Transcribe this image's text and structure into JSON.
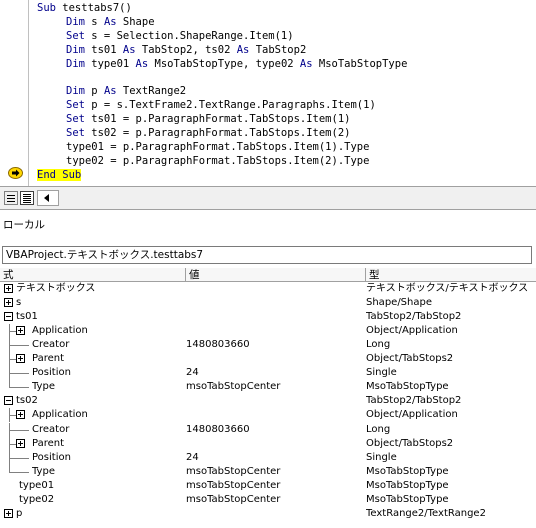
{
  "code": {
    "lines": [
      {
        "indent": 0,
        "tokens": [
          {
            "t": "Sub",
            "kw": true
          },
          {
            "t": " testtabs7()"
          }
        ]
      },
      {
        "indent": 1,
        "tokens": [
          {
            "t": "Dim",
            "kw": true
          },
          {
            "t": " s "
          },
          {
            "t": "As",
            "kw": true
          },
          {
            "t": " Shape"
          }
        ]
      },
      {
        "indent": 1,
        "tokens": [
          {
            "t": "Set",
            "kw": true
          },
          {
            "t": " s = Selection.ShapeRange.Item(1)"
          }
        ]
      },
      {
        "indent": 1,
        "tokens": [
          {
            "t": "Dim",
            "kw": true
          },
          {
            "t": " ts01 "
          },
          {
            "t": "As",
            "kw": true
          },
          {
            "t": " TabStop2, ts02 "
          },
          {
            "t": "As",
            "kw": true
          },
          {
            "t": " TabStop2"
          }
        ]
      },
      {
        "indent": 1,
        "tokens": [
          {
            "t": "Dim",
            "kw": true
          },
          {
            "t": " type01 "
          },
          {
            "t": "As",
            "kw": true
          },
          {
            "t": " MsoTabStopType, type02 "
          },
          {
            "t": "As",
            "kw": true
          },
          {
            "t": " MsoTabStopType"
          }
        ]
      },
      {
        "indent": 0,
        "tokens": []
      },
      {
        "indent": 1,
        "tokens": [
          {
            "t": "Dim",
            "kw": true
          },
          {
            "t": " p "
          },
          {
            "t": "As",
            "kw": true
          },
          {
            "t": " TextRange2"
          }
        ]
      },
      {
        "indent": 1,
        "tokens": [
          {
            "t": "Set",
            "kw": true
          },
          {
            "t": " p = s.TextFrame2.TextRange.Paragraphs.Item(1)"
          }
        ]
      },
      {
        "indent": 1,
        "tokens": [
          {
            "t": "Set",
            "kw": true
          },
          {
            "t": " ts01 = p.ParagraphFormat.TabStops.Item(1)"
          }
        ]
      },
      {
        "indent": 1,
        "tokens": [
          {
            "t": "Set",
            "kw": true
          },
          {
            "t": " ts02 = p.ParagraphFormat.TabStops.Item(2)"
          }
        ]
      },
      {
        "indent": 1,
        "tokens": [
          {
            "t": "type01 = p.ParagraphFormat.TabStops.Item(1).Type"
          }
        ]
      },
      {
        "indent": 1,
        "tokens": [
          {
            "t": "type02 = p.ParagraphFormat.TabStops.Item(2).Type"
          }
        ]
      },
      {
        "indent": 0,
        "tokens": [
          {
            "t": "End Sub",
            "kw": true,
            "hl": true
          }
        ]
      }
    ],
    "exec_line_index": 12,
    "exec_arrow_color": "#ffd700"
  },
  "locals": {
    "title": "ローカル",
    "context": "VBAProject.テキストボックス.testtabs7",
    "headers": [
      "式",
      "値",
      "型"
    ],
    "rows": [
      {
        "level": 0,
        "expander": "plus",
        "expr": "テキストボックス",
        "value": "",
        "type": "テキストボックス/テキストボックス"
      },
      {
        "level": 0,
        "expander": "plus",
        "expr": "s",
        "value": "",
        "type": "Shape/Shape"
      },
      {
        "level": 0,
        "expander": "minus",
        "expr": "ts01",
        "value": "",
        "type": "TabStop2/TabStop2"
      },
      {
        "level": 1,
        "expander": "plus",
        "expr": "Application",
        "value": "",
        "type": "Object/Application"
      },
      {
        "level": 1,
        "expander": "none",
        "expr": "Creator",
        "value": "1480803660",
        "type": "Long"
      },
      {
        "level": 1,
        "expander": "plus",
        "expr": "Parent",
        "value": "",
        "type": "Object/TabStops2"
      },
      {
        "level": 1,
        "expander": "none",
        "expr": "Position",
        "value": "24",
        "type": "Single"
      },
      {
        "level": 1,
        "expander": "none",
        "expr": "Type",
        "value": "msoTabStopCenter",
        "type": "MsoTabStopType",
        "last": true
      },
      {
        "level": 0,
        "expander": "minus",
        "expr": "ts02",
        "value": "",
        "type": "TabStop2/TabStop2"
      },
      {
        "level": 1,
        "expander": "plus",
        "expr": "Application",
        "value": "",
        "type": "Object/Application"
      },
      {
        "level": 1,
        "expander": "none",
        "expr": "Creator",
        "value": "1480803660",
        "type": "Long"
      },
      {
        "level": 1,
        "expander": "plus",
        "expr": "Parent",
        "value": "",
        "type": "Object/TabStops2"
      },
      {
        "level": 1,
        "expander": "none",
        "expr": "Position",
        "value": "24",
        "type": "Single"
      },
      {
        "level": 1,
        "expander": "none",
        "expr": "Type",
        "value": "msoTabStopCenter",
        "type": "MsoTabStopType",
        "last": true
      },
      {
        "level": 0,
        "expander": "none",
        "expr": "type01",
        "value": "msoTabStopCenter",
        "type": "MsoTabStopType"
      },
      {
        "level": 0,
        "expander": "none",
        "expr": "type02",
        "value": "msoTabStopCenter",
        "type": "MsoTabStopType"
      },
      {
        "level": 0,
        "expander": "plus",
        "expr": "p",
        "value": "",
        "type": "TextRange2/TextRange2"
      }
    ]
  }
}
